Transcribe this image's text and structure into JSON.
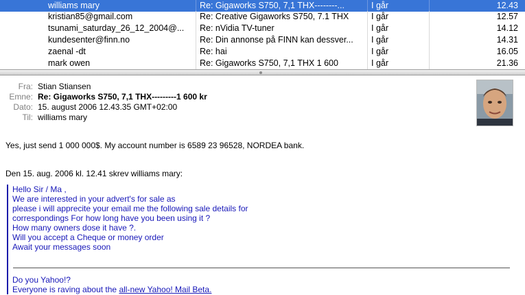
{
  "message_list": {
    "rows": [
      {
        "from": "williams mary",
        "subject": "Re: Gigaworks S750, 7,1 THX--------...",
        "date": "I går",
        "time": "12.43",
        "selected": true
      },
      {
        "from": "kristian85@gmail.com",
        "subject": "Re: Creative Gigaworks S750, 7.1 THX",
        "date": "I går",
        "time": "12.57",
        "selected": false
      },
      {
        "from": "tsunami_saturday_26_12_2004@...",
        "subject": "Re: nVidia TV-tuner",
        "date": "I går",
        "time": "14.12",
        "selected": false
      },
      {
        "from": "kundesenter@finn.no",
        "subject": "Re: Din annonse på FINN kan dessver...",
        "date": "I går",
        "time": "14.31",
        "selected": false
      },
      {
        "from": "zaenal -dt",
        "subject": "Re: hai",
        "date": "I går",
        "time": "16.05",
        "selected": false
      },
      {
        "from": "mark owen",
        "subject": "Re: Gigaworks S750, 7,1 THX 1 600",
        "date": "I går",
        "time": "21.36",
        "selected": false
      }
    ]
  },
  "header": {
    "from_label": "Fra:",
    "from_value": "Stian Stiansen",
    "subject_label": "Emne:",
    "subject_value": "Re: Gigaworks S750, 7,1 THX---------1 600 kr",
    "date_label": "Dato:",
    "date_value": "15. august 2006 12.43.35 GMT+02:00",
    "to_label": "Til:",
    "to_value": "williams mary"
  },
  "body": {
    "reply": "Yes, just send 1 000 000$. My account number is 6589 23 96528, NORDEA bank.",
    "attribution": "Den 15. aug. 2006 kl. 12.41 skrev williams mary:",
    "quote_lines": [
      "Hello Sir / Ma ,",
      "We are interested in your advert's for sale as",
      "please i will apprecite your email me the following sale details for",
      "correspondings For how long have you been using it ?",
      "How many owners dose it have ?.",
      "Will you accept a Cheque or money order",
      "Await your messages soon"
    ],
    "footer_line1": "Do you Yahoo!?",
    "footer_prefix": "Everyone is raving about the ",
    "footer_link": "all-new Yahoo! Mail Beta."
  },
  "colors": {
    "selection": "#3875d7",
    "quote": "#1717b8",
    "label": "#7f7f7f"
  },
  "icons": {
    "avatar": "sender-photo"
  }
}
